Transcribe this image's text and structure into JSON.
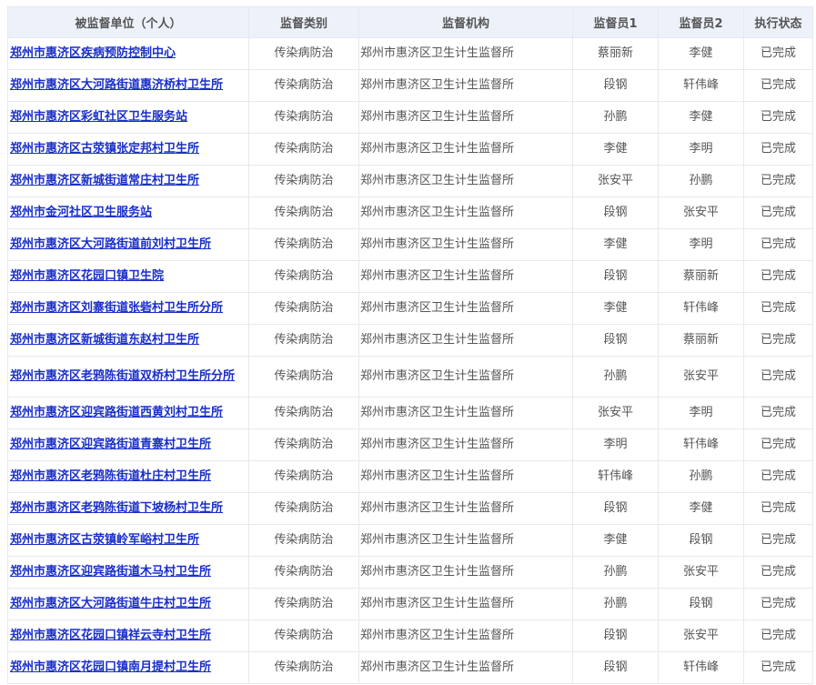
{
  "table": {
    "headers": {
      "unit": "被监督单位（个人）",
      "category": "监督类别",
      "org": "监督机构",
      "inspector1": "监督员1",
      "inspector2": "监督员2",
      "status": "执行状态"
    },
    "rows": [
      {
        "unit": "郑州市惠济区疾病预防控制中心",
        "category": "传染病防治",
        "org": "郑州市惠济区卫生计生监督所",
        "inspector1": "蔡丽新",
        "inspector2": "李健",
        "status": "已完成"
      },
      {
        "unit": "郑州市惠济区大河路街道惠济桥村卫生所",
        "category": "传染病防治",
        "org": "郑州市惠济区卫生计生监督所",
        "inspector1": "段钢",
        "inspector2": "轩伟峰",
        "status": "已完成"
      },
      {
        "unit": "郑州市惠济区彩虹社区卫生服务站",
        "category": "传染病防治",
        "org": "郑州市惠济区卫生计生监督所",
        "inspector1": "孙鹏",
        "inspector2": "李健",
        "status": "已完成"
      },
      {
        "unit": "郑州市惠济区古荥镇张定邦村卫生所",
        "category": "传染病防治",
        "org": "郑州市惠济区卫生计生监督所",
        "inspector1": "李健",
        "inspector2": "李明",
        "status": "已完成"
      },
      {
        "unit": "郑州市惠济区新城街道常庄村卫生所",
        "category": "传染病防治",
        "org": "郑州市惠济区卫生计生监督所",
        "inspector1": "张安平",
        "inspector2": "孙鹏",
        "status": "已完成"
      },
      {
        "unit": "郑州市金河社区卫生服务站",
        "category": "传染病防治",
        "org": "郑州市惠济区卫生计生监督所",
        "inspector1": "段钢",
        "inspector2": "张安平",
        "status": "已完成"
      },
      {
        "unit": "郑州市惠济区大河路街道前刘村卫生所",
        "category": "传染病防治",
        "org": "郑州市惠济区卫生计生监督所",
        "inspector1": "李健",
        "inspector2": "李明",
        "status": "已完成"
      },
      {
        "unit": "郑州市惠济区花园口镇卫生院",
        "category": "传染病防治",
        "org": "郑州市惠济区卫生计生监督所",
        "inspector1": "段钢",
        "inspector2": "蔡丽新",
        "status": "已完成"
      },
      {
        "unit": "郑州市惠济区刘寨街道张砦村卫生所分所",
        "category": "传染病防治",
        "org": "郑州市惠济区卫生计生监督所",
        "inspector1": "李健",
        "inspector2": "轩伟峰",
        "status": "已完成"
      },
      {
        "unit": "郑州市惠济区新城街道东赵村卫生所",
        "category": "传染病防治",
        "org": "郑州市惠济区卫生计生监督所",
        "inspector1": "段钢",
        "inspector2": "蔡丽新",
        "status": "已完成"
      },
      {
        "unit": "郑州市惠济区老鸦陈街道双桥村卫生所分所",
        "category": "传染病防治",
        "org": "郑州市惠济区卫生计生监督所",
        "inspector1": "孙鹏",
        "inspector2": "张安平",
        "status": "已完成"
      },
      {
        "unit": "郑州市惠济区迎宾路街道西黄刘村卫生所",
        "category": "传染病防治",
        "org": "郑州市惠济区卫生计生监督所",
        "inspector1": "张安平",
        "inspector2": "李明",
        "status": "已完成"
      },
      {
        "unit": "郑州市惠济区迎宾路街道青寨村卫生所",
        "category": "传染病防治",
        "org": "郑州市惠济区卫生计生监督所",
        "inspector1": "李明",
        "inspector2": "轩伟峰",
        "status": "已完成"
      },
      {
        "unit": "郑州市惠济区老鸦陈街道杜庄村卫生所",
        "category": "传染病防治",
        "org": "郑州市惠济区卫生计生监督所",
        "inspector1": "轩伟峰",
        "inspector2": "孙鹏",
        "status": "已完成"
      },
      {
        "unit": "郑州市惠济区老鸦陈街道下坡杨村卫生所",
        "category": "传染病防治",
        "org": "郑州市惠济区卫生计生监督所",
        "inspector1": "段钢",
        "inspector2": "李健",
        "status": "已完成"
      },
      {
        "unit": "郑州市惠济区古荥镇岭军峪村卫生所",
        "category": "传染病防治",
        "org": "郑州市惠济区卫生计生监督所",
        "inspector1": "李健",
        "inspector2": "段钢",
        "status": "已完成"
      },
      {
        "unit": "郑州市惠济区迎宾路街道木马村卫生所",
        "category": "传染病防治",
        "org": "郑州市惠济区卫生计生监督所",
        "inspector1": "孙鹏",
        "inspector2": "张安平",
        "status": "已完成"
      },
      {
        "unit": "郑州市惠济区大河路街道牛庄村卫生所",
        "category": "传染病防治",
        "org": "郑州市惠济区卫生计生监督所",
        "inspector1": "孙鹏",
        "inspector2": "段钢",
        "status": "已完成"
      },
      {
        "unit": "郑州市惠济区花园口镇祥云寺村卫生所",
        "category": "传染病防治",
        "org": "郑州市惠济区卫生计生监督所",
        "inspector1": "段钢",
        "inspector2": "张安平",
        "status": "已完成"
      },
      {
        "unit": "郑州市惠济区花园口镇南月提村卫生所",
        "category": "传染病防治",
        "org": "郑州市惠济区卫生计生监督所",
        "inspector1": "段钢",
        "inspector2": "轩伟峰",
        "status": "已完成"
      }
    ]
  },
  "colors": {
    "link": "#1a2fc9",
    "header_bg": "#edf2fa",
    "border": "#e6e9ee",
    "text": "#555555"
  }
}
